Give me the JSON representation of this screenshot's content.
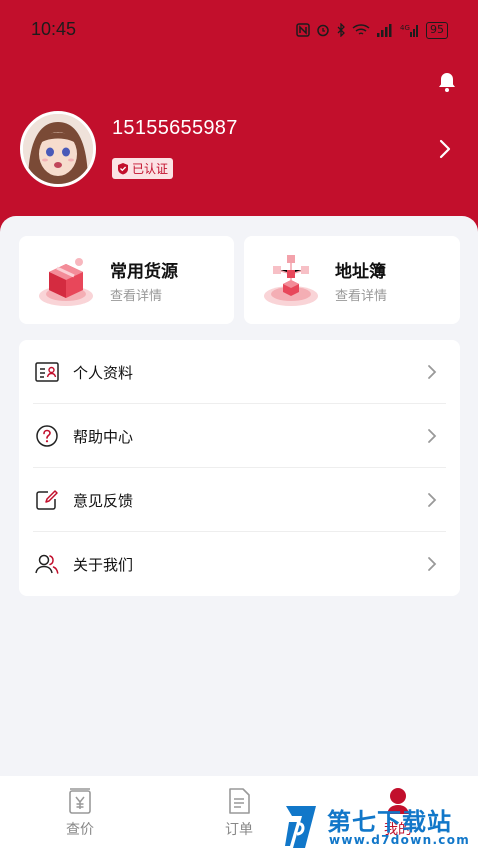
{
  "status_bar": {
    "time": "10:45",
    "battery": "95"
  },
  "profile": {
    "phone": "15155655987",
    "verified_label": "已认证"
  },
  "cards": [
    {
      "title": "常用货源",
      "subtitle": "查看详情",
      "icon": "box-icon"
    },
    {
      "title": "地址簿",
      "subtitle": "查看详情",
      "icon": "network-icon"
    }
  ],
  "menu": [
    {
      "label": "个人资料",
      "icon": "id-card-icon"
    },
    {
      "label": "帮助中心",
      "icon": "help-icon"
    },
    {
      "label": "意见反馈",
      "icon": "edit-icon"
    },
    {
      "label": "关于我们",
      "icon": "users-icon"
    }
  ],
  "tabbar": [
    {
      "label": "查价",
      "icon": "price-icon",
      "active": false
    },
    {
      "label": "订单",
      "icon": "document-icon",
      "active": false
    },
    {
      "label": "我的",
      "icon": "profile-icon",
      "active": true
    }
  ],
  "watermark": {
    "text": "第七下载站",
    "url": "www.d7down.com"
  },
  "colors": {
    "brand": "#c20f2c",
    "background": "#f3f4f8",
    "watermark": "#1177c9"
  }
}
